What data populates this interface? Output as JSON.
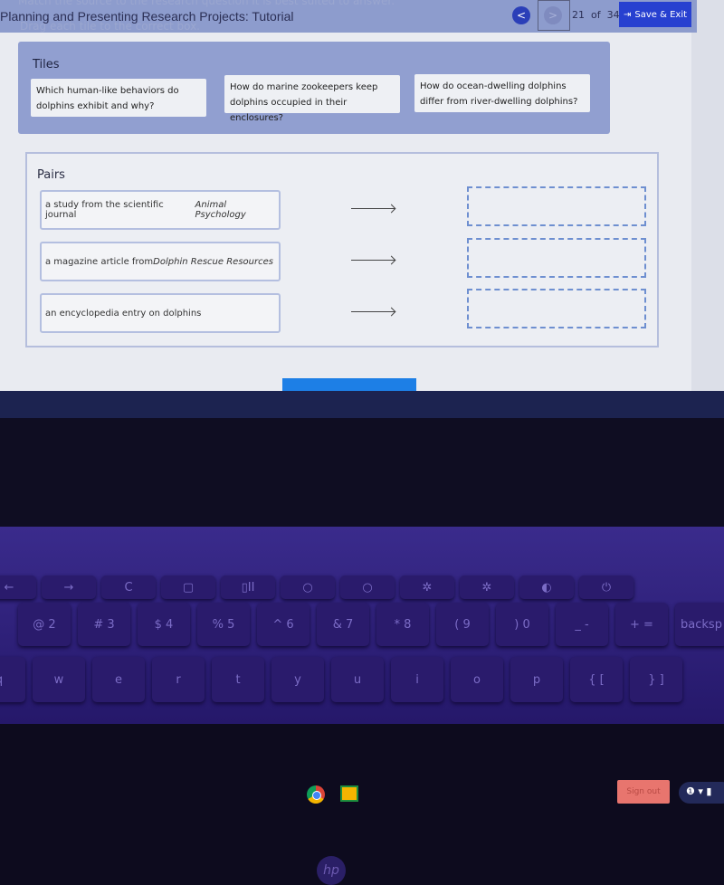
{
  "header": {
    "instruction": "Match the source to the research question it is best suited to answer.",
    "instruction2": "Drag each tile to the correct box.",
    "title": "Planning and Presenting Research Projects: Tutorial",
    "prev_icon": "chevron-left",
    "next_icon": "chevron-right",
    "current": "21",
    "of": "of",
    "total": "34",
    "save_label": "Save & Exit"
  },
  "tiles": {
    "heading": "Tiles",
    "items": [
      "Which human-like behaviors do dolphins exhibit and why?",
      "How do marine zookeepers keep dolphins occupied in their enclosures?",
      "How do ocean-dwelling dolphins differ from river-dwelling dolphins?"
    ]
  },
  "pairs": {
    "heading": "Pairs",
    "items": [
      {
        "prefix": "a study from the scientific journal ",
        "italic": "Animal Psychology"
      },
      {
        "prefix": "a magazine article from ",
        "italic": "Dolphin Rescue Resources"
      },
      {
        "prefix": "an encyclopedia entry on dolphins",
        "italic": ""
      }
    ]
  },
  "shelf": {
    "apps": [
      "chrome",
      "google-classroom"
    ],
    "signout": "Sign out",
    "tray": "❶ ▾ ▮"
  },
  "laptop": {
    "brand": "hp",
    "keys_row1": [
      "←",
      "→",
      "C",
      "▢",
      "▯II",
      "○",
      "○",
      "✲",
      "✲",
      "◐",
      "⏻"
    ],
    "keys_row2": [
      "@ 2",
      "# 3",
      "$ 4",
      "% 5",
      "^ 6",
      "& 7",
      "* 8",
      "( 9",
      ") 0",
      "_ -",
      "+ =",
      "backsp"
    ],
    "keys_row3": [
      "q",
      "w",
      "e",
      "r",
      "t",
      "y",
      "u",
      "i",
      "o",
      "p",
      "{ [",
      "} ]"
    ]
  },
  "colors": {
    "header": "#8d9ccd",
    "save_button": "#2740d0",
    "signout": "#e8756e",
    "drop_border": "#6e8fd0"
  }
}
